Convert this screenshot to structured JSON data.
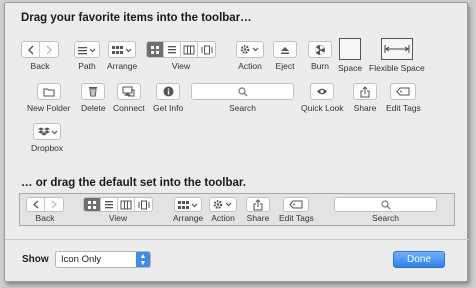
{
  "header": {
    "title": "Drag your favorite items into the toolbar…"
  },
  "palette": {
    "back": "Back",
    "path": "Path",
    "arrange": "Arrange",
    "view": "View",
    "action": "Action",
    "eject": "Eject",
    "burn": "Burn",
    "space": "Space",
    "flexible_space": "Flexible Space",
    "new_folder": "New Folder",
    "delete": "Delete",
    "connect": "Connect",
    "get_info": "Get Info",
    "search": "Search",
    "quick_look": "Quick Look",
    "share": "Share",
    "edit_tags": "Edit Tags",
    "dropbox": "Dropbox"
  },
  "default_set": {
    "title": "… or drag the default set into the toolbar.",
    "back": "Back",
    "view": "View",
    "arrange": "Arrange",
    "action": "Action",
    "share": "Share",
    "edit_tags": "Edit Tags",
    "search": "Search"
  },
  "footer": {
    "show_label": "Show",
    "show_value": "Icon Only",
    "done_label": "Done"
  },
  "colors": {
    "accent": "#2a82ef",
    "selected_segment": "#6f6f6f"
  }
}
